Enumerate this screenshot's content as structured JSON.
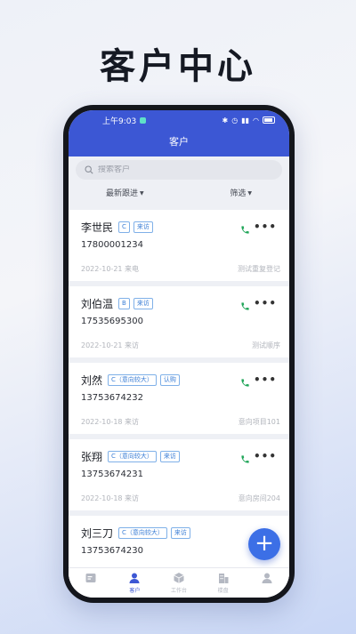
{
  "headline": "客户中心",
  "statusbar": {
    "time": "上午9:03",
    "icons": [
      "bluetooth-icon",
      "alarm-icon",
      "signal-icon",
      "signal-icon",
      "wifi-icon",
      "battery-icon"
    ]
  },
  "appbar": {
    "title": "客户"
  },
  "search": {
    "placeholder": "搜索客户"
  },
  "filters": {
    "sort_label": "最新跟进",
    "filter_label": "筛选"
  },
  "customers": [
    {
      "name": "李世民",
      "tags": [
        "C",
        "来访"
      ],
      "phone": "17800001234",
      "date_source": "2022-10-21 来电",
      "note": "测试重复登记"
    },
    {
      "name": "刘伯温",
      "tags": [
        "B",
        "来访"
      ],
      "phone": "17535695300",
      "date_source": "2022-10-21 来访",
      "note": "测试顺序"
    },
    {
      "name": "刘然",
      "tags": [
        "C（意向较大）",
        "认购"
      ],
      "phone": "13753674232",
      "date_source": "2022-10-18 来访",
      "note": "意向项目101"
    },
    {
      "name": "张翔",
      "tags": [
        "C（意向较大）",
        "来访"
      ],
      "phone": "13753674231",
      "date_source": "2022-10-18 来访",
      "note": "意向房间204"
    },
    {
      "name": "刘三刀",
      "tags": [
        "C（意向较大）",
        "来访"
      ],
      "phone": "13753674230",
      "date_source": "",
      "note": ""
    }
  ],
  "fab": {
    "label": "+"
  },
  "tabbar": {
    "items": [
      {
        "label": "",
        "icon": "report-icon"
      },
      {
        "label": "客户",
        "icon": "person-icon"
      },
      {
        "label": "工作台",
        "icon": "box-icon"
      },
      {
        "label": "楼盘",
        "icon": "building-icon"
      },
      {
        "label": "",
        "icon": "profile-icon"
      }
    ],
    "active_index": 1
  },
  "colors": {
    "primary": "#3c57d4",
    "tag": "#3c7fd6",
    "phone_icon": "#22a65a",
    "fab": "#3c6fe6"
  }
}
